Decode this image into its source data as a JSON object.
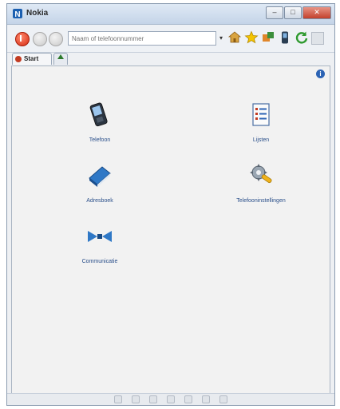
{
  "window": {
    "title": "Nokia",
    "controls": {
      "minimize": "–",
      "maximize": "□",
      "close": "✕"
    }
  },
  "toolbar": {
    "address_placeholder": "Naam of telefoonnummer",
    "dropdown_glyph": "▾",
    "icons": [
      "home-icon",
      "star-icon",
      "puzzle-icon",
      "phone-icon",
      "refresh-icon",
      "disabled-box-icon"
    ]
  },
  "tabs": {
    "start_label": "Start"
  },
  "launchers": [
    {
      "name": "Telefoon",
      "icon": "phone-icon"
    },
    {
      "name": "Lijsten",
      "icon": "list-icon"
    },
    {
      "name": "Adresboek",
      "icon": "addressbook-icon"
    },
    {
      "name": "Telefooninstellingen",
      "icon": "settings-icon"
    },
    {
      "name": "Communicatie",
      "icon": "communication-icon"
    }
  ],
  "colors": {
    "accent": "#2c63b4",
    "label": "#2a4f8a",
    "stop": "#d52a10"
  }
}
